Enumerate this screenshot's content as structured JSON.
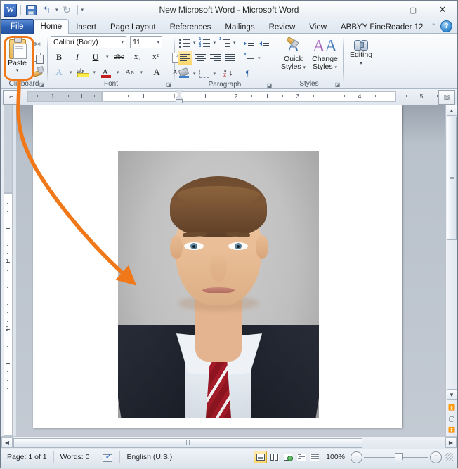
{
  "window": {
    "title": "New Microsoft Word  -  Microsoft Word",
    "minimize": "—",
    "maximize": "▢",
    "close": "✕"
  },
  "quick_access": {
    "logo": "W",
    "save_icon": "save-icon",
    "undo_icon": "↰",
    "undo_caret": "▾",
    "redo_icon": "↻",
    "customize_caret": "▾"
  },
  "tabs": [
    {
      "label": "File",
      "active": false,
      "type": "file"
    },
    {
      "label": "Home",
      "active": true,
      "type": "normal"
    },
    {
      "label": "Insert",
      "active": false,
      "type": "normal"
    },
    {
      "label": "Page Layout",
      "active": false,
      "type": "normal"
    },
    {
      "label": "References",
      "active": false,
      "type": "normal"
    },
    {
      "label": "Mailings",
      "active": false,
      "type": "normal"
    },
    {
      "label": "Review",
      "active": false,
      "type": "normal"
    },
    {
      "label": "View",
      "active": false,
      "type": "normal"
    },
    {
      "label": "ABBYY FineReader 12",
      "active": false,
      "type": "normal"
    }
  ],
  "tab_right": {
    "minimize_ribbon": "⌃",
    "help": "?"
  },
  "ribbon": {
    "clipboard": {
      "group_label": "Clipboard",
      "paste_label": "Paste",
      "paste_caret": "▾",
      "cut_label": "Cut",
      "copy_label": "Copy",
      "format_painter_label": "Format Painter",
      "dialog_launcher": "◪"
    },
    "font": {
      "group_label": "Font",
      "font_name": "Calibri (Body)",
      "font_size": "11",
      "caret": "▾",
      "bold": "B",
      "italic": "I",
      "underline": "U",
      "strikethrough": "abc",
      "subscript": "x₂",
      "superscript": "x²",
      "clear_formatting": "clear-formatting",
      "text_effects": "A",
      "highlight": "ab",
      "font_color": "A",
      "change_case": "Aa",
      "grow_font": "A",
      "shrink_font": "A",
      "dialog_launcher": "◪"
    },
    "paragraph": {
      "group_label": "Paragraph",
      "bullets": "bullets",
      "numbering": "numbering",
      "multilevel": "multilevel-list",
      "decrease_indent": "decrease-indent",
      "increase_indent": "increase-indent",
      "align_left": "align-left",
      "align_center": "align-center",
      "align_right": "align-right",
      "justify": "justify",
      "line_spacing": "line-spacing",
      "shading": "shading",
      "borders": "borders",
      "sort": "sort",
      "show_marks": "¶",
      "dialog_launcher": "◪"
    },
    "styles": {
      "group_label": "Styles",
      "quick_styles_line1": "Quick",
      "quick_styles_line2": "Styles",
      "change_styles_line1": "Change",
      "change_styles_line2": "Styles",
      "caret": "▾",
      "dialog_launcher": "◪"
    },
    "editing": {
      "group_label": "Editing",
      "editing_label": "Editing",
      "caret": "▾"
    }
  },
  "ruler": {
    "tab_selector": "⌐",
    "horizontal_numbers": [
      "1",
      "1",
      "2",
      "3",
      "4",
      "5"
    ],
    "vertical_numbers": [
      "1",
      "2"
    ],
    "unit": "inches"
  },
  "document": {
    "page_background": "#ffffff",
    "image": {
      "name": "portrait-photo",
      "alt": "Portrait photo of a young man in a dark suit, white shirt and red striped tie on a gray background"
    }
  },
  "annotation": {
    "color": "#f07818",
    "target": "paste-button",
    "type": "curved-arrow",
    "description": "Orange curved arrow from the Paste button to the pasted photo"
  },
  "status_bar": {
    "page": "Page: 1 of 1",
    "words": "Words: 0",
    "proofing_icon": "proofing-errors-icon",
    "language": "English (U.S.)",
    "views": [
      {
        "name": "print-layout",
        "active": true
      },
      {
        "name": "full-screen-reading",
        "active": false
      },
      {
        "name": "web-layout",
        "active": false
      },
      {
        "name": "outline",
        "active": false
      },
      {
        "name": "draft",
        "active": false
      }
    ],
    "zoom_level": "100%",
    "zoom_out": "−",
    "zoom_in": "+"
  },
  "scrollbars": {
    "up_arrow": "▲",
    "down_arrow": "▼",
    "left_arrow": "◀",
    "right_arrow": "▶",
    "previous_page": "⏫",
    "select_browse_object": "◯",
    "next_page": "⏬",
    "split_handle": "split-handle"
  }
}
